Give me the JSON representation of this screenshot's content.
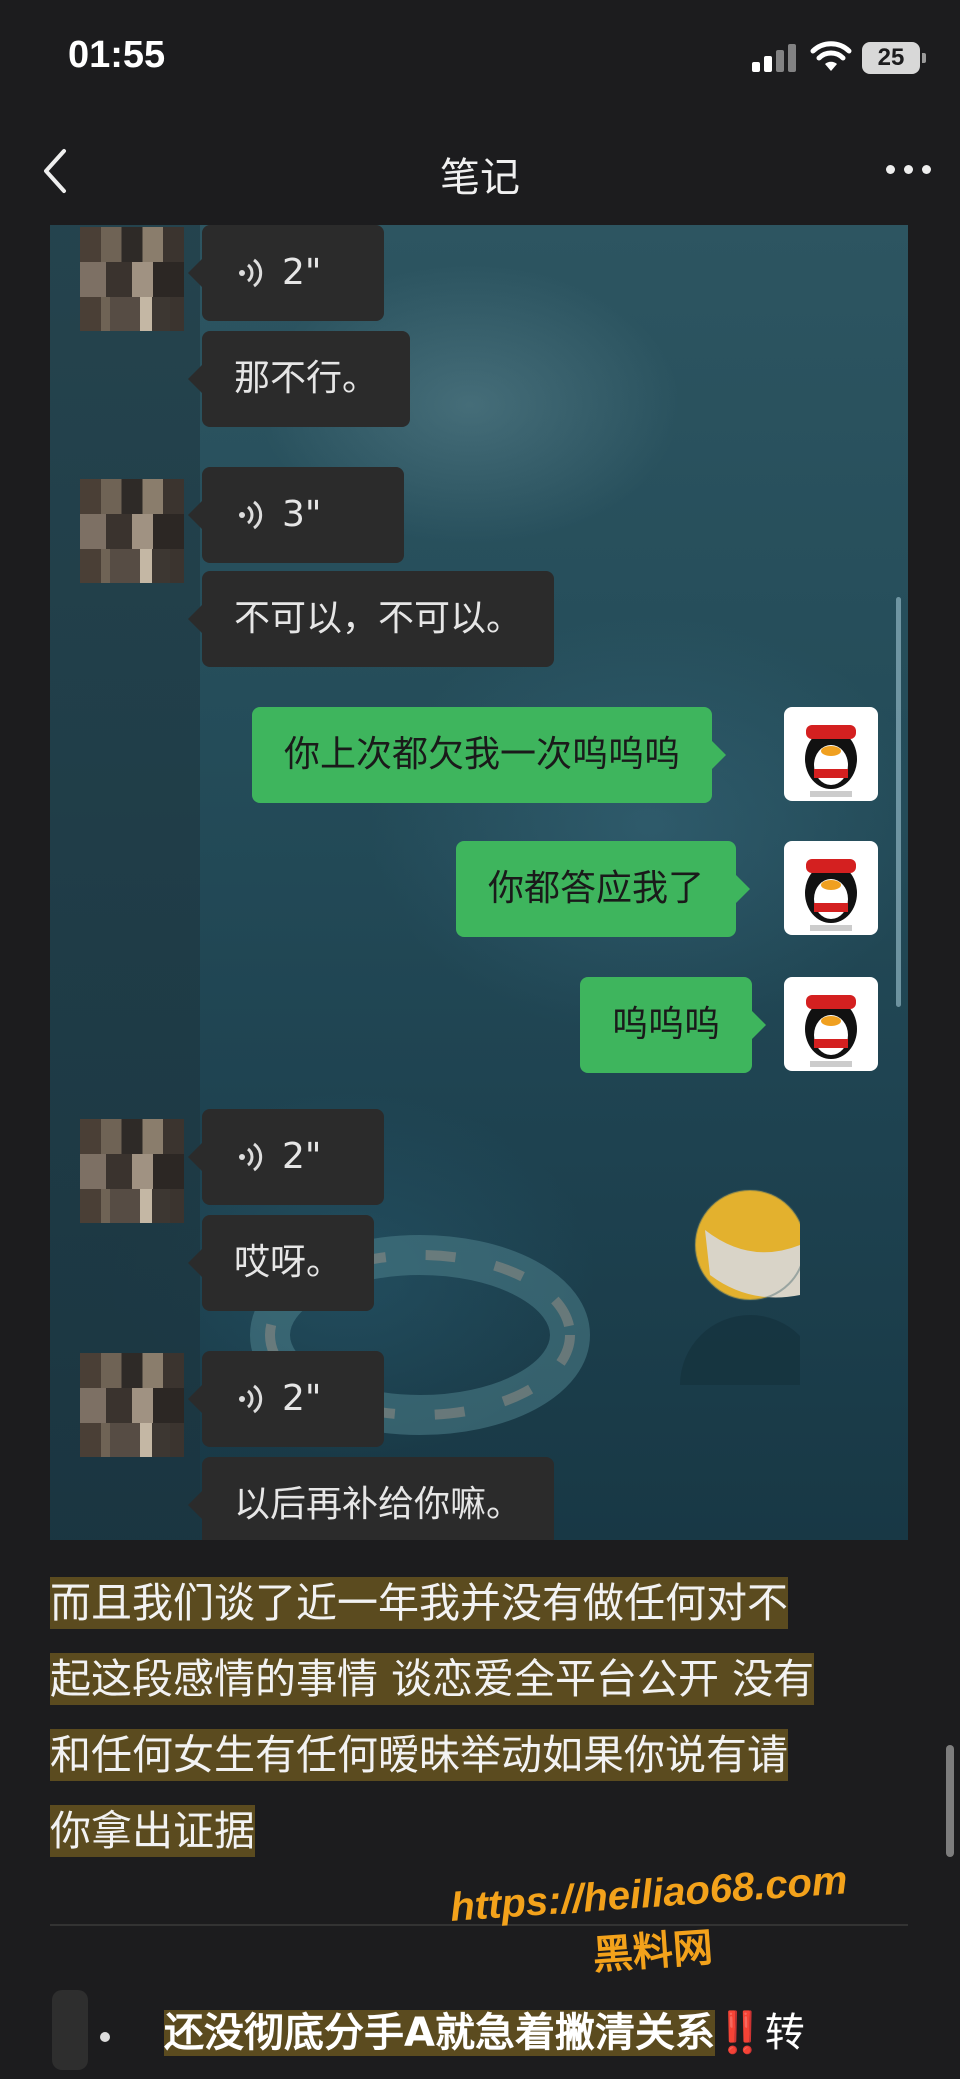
{
  "status_bar": {
    "time": "01:55",
    "battery": "25"
  },
  "nav": {
    "title": "笔记"
  },
  "chat": {
    "messages": [
      {
        "side": "in",
        "type": "voice",
        "duration": "2\""
      },
      {
        "side": "in",
        "type": "text",
        "text": "那不行。"
      },
      {
        "side": "in",
        "type": "voice",
        "duration": "3\""
      },
      {
        "side": "in",
        "type": "text",
        "text": "不可以，不可以。"
      },
      {
        "side": "out",
        "type": "text",
        "text": "你上次都欠我一次呜呜呜"
      },
      {
        "side": "out",
        "type": "text",
        "text": "你都答应我了"
      },
      {
        "side": "out",
        "type": "text",
        "text": "呜呜呜"
      },
      {
        "side": "in",
        "type": "voice",
        "duration": "2\""
      },
      {
        "side": "in",
        "type": "text",
        "text": "哎呀。"
      },
      {
        "side": "in",
        "type": "voice",
        "duration": "2\""
      },
      {
        "side": "in",
        "type": "text",
        "text": "以后再补给你嘛。"
      }
    ]
  },
  "note": {
    "lines": [
      "而且我们谈了近一年我并没有做任何对不",
      "起这段感情的事情 谈恋爱全平台公开 没有",
      "和任何女生有任何暧昧举动如果你说有请",
      "你拿出证据"
    ]
  },
  "watermark": {
    "url": "https://heiliao68.com",
    "name": "黑料网"
  },
  "bottom": {
    "bullet_text": "还没彻底分手A就急着撇清关系",
    "bang": "‼️",
    "tail": "转"
  },
  "colors": {
    "highlight": "#5b4b1f",
    "out_bubble": "#3eb55d",
    "in_bubble": "#2b2b2b",
    "watermark": "#f3a21b"
  }
}
